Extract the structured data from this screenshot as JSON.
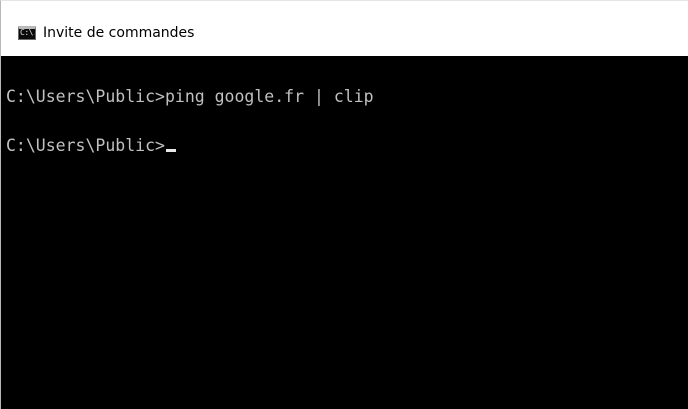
{
  "window": {
    "title": "Invite de commandes",
    "icon": "cmd-icon",
    "icon_text": "C:\\."
  },
  "console": {
    "lines": [
      {
        "prompt": "C:\\Users\\Public>",
        "command": "ping google.fr | clip"
      },
      {
        "prompt": "C:\\Users\\Public>",
        "command": ""
      }
    ],
    "text_color": "#c0c0c0",
    "background_color": "#000000"
  }
}
